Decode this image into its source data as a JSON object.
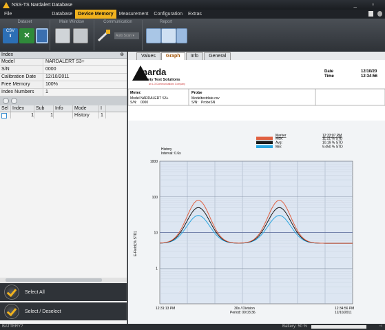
{
  "window": {
    "title": "NSS-TS  Nardalert Database"
  },
  "menu": {
    "items": [
      {
        "label": "File"
      },
      {
        "label": "Database"
      },
      {
        "label": "Device Memory",
        "active": true
      },
      {
        "label": "Measurement"
      },
      {
        "label": "Configuration"
      },
      {
        "label": "Extras"
      }
    ]
  },
  "ribbon": {
    "groups": [
      {
        "label": "Dataset"
      },
      {
        "label": "Main Window"
      },
      {
        "label": "Communication"
      },
      {
        "label": "Report"
      }
    ],
    "csv_label": "CSV",
    "autoscan_label": "Auto Scan"
  },
  "index": {
    "title": "Index",
    "props": [
      {
        "k": "Model",
        "v": "NARDALERT S3+"
      },
      {
        "k": "S/N",
        "v": "0000"
      },
      {
        "k": "Calibration Date",
        "v": "12/10/2011"
      },
      {
        "k": "Free Memory",
        "v": "100%"
      },
      {
        "k": "Index Numbers",
        "v": "1"
      }
    ],
    "columns": [
      "Sel",
      "Index",
      "Sub",
      "Info",
      "Mode",
      "I"
    ],
    "rows": [
      [
        "",
        "1",
        "1",
        "",
        "History",
        "1"
      ]
    ]
  },
  "actions": {
    "select_all": "Select All",
    "select_deselect": "Select / Deselect"
  },
  "tabs": [
    "Values",
    "Graph",
    "Info",
    "General"
  ],
  "report": {
    "brand": "narda",
    "brand_sub": "Safety Test Solutions",
    "brand_tiny": "an L-3 Communications Company",
    "date_label": "Date",
    "date_value": "12/10/20",
    "time_label": "Time",
    "time_value": "12:34:56",
    "meter_label": "Meter:",
    "meter_model_k": "Model",
    "meter_model_v": "NARDALERT S3+",
    "meter_sn_k": "S/N:",
    "meter_sn_v": "0000",
    "probe_label": "Probe",
    "probe_model_k": "Model:",
    "probe_model_v": "testdate.csv",
    "probe_sn_k": "S/N:",
    "probe_sn_v": "ProbeSN"
  },
  "chart_data": {
    "type": "line",
    "annotation": "History\nInterval: 0.6s",
    "marker_label": "Marker",
    "marker_time": "12:33:07 PM",
    "series": [
      {
        "name": "Max",
        "value": "11.21 % STD",
        "color": "#e06040"
      },
      {
        "name": "Avg",
        "value": "10.19 % STD",
        "color": "#1a1a1a"
      },
      {
        "name": "Min",
        "value": "9.450 % STD",
        "color": "#2aa6e0"
      }
    ],
    "ylabel": "E-Field [% STD]",
    "yscale": "log",
    "ylim": [
      0.1,
      1000
    ],
    "yticks": [
      "1000",
      "100",
      "10",
      "1"
    ],
    "x_start": "12:31:13 PM",
    "x_end_time": "12:34:56 PM",
    "x_end_date": "12/10/2011",
    "x_division": "30s / Division",
    "x_period": "Period: 00:03:36",
    "grid": true,
    "curve_peaks": {
      "Max": 80,
      "Avg": 50,
      "Min": 30
    },
    "baseline": 5,
    "ref_line": 10
  },
  "status": {
    "battery_left": "BATTERY?",
    "battery_right": "Battery: 50 %"
  }
}
